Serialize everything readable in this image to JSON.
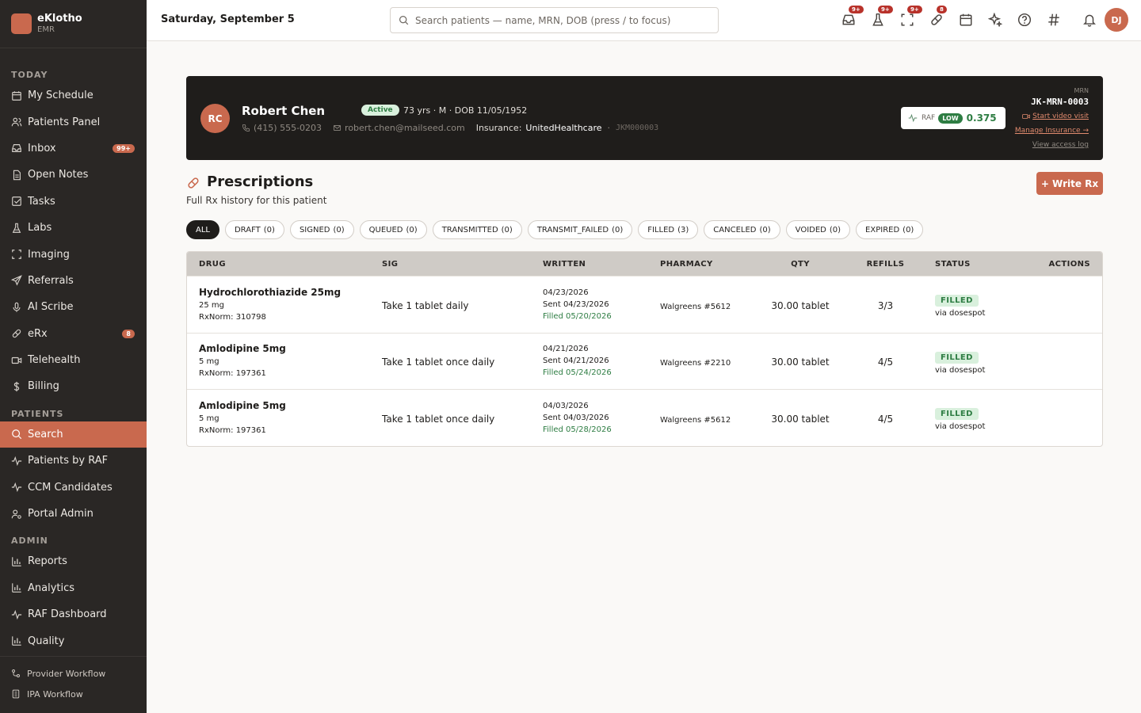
{
  "app": {
    "name": "eKlotho",
    "sub": "EMR"
  },
  "sidebar": {
    "sections": [
      {
        "title": "TODAY",
        "items": [
          {
            "label": "My Schedule",
            "icon": "calendar-icon"
          },
          {
            "label": "Patients Panel",
            "icon": "users-icon"
          },
          {
            "label": "Inbox",
            "icon": "inbox-icon",
            "badge": "99+"
          },
          {
            "label": "Open Notes",
            "icon": "note-icon"
          },
          {
            "label": "Tasks",
            "icon": "check-square-icon"
          },
          {
            "label": "Labs",
            "icon": "flask-icon"
          },
          {
            "label": "Imaging",
            "icon": "scan-icon"
          },
          {
            "label": "Referrals",
            "icon": "send-icon"
          },
          {
            "label": "AI Scribe",
            "icon": "mic-icon"
          },
          {
            "label": "eRx",
            "icon": "pill-icon",
            "badge": "8"
          },
          {
            "label": "Telehealth",
            "icon": "video-icon"
          },
          {
            "label": "Billing",
            "icon": "dollar-icon"
          }
        ]
      },
      {
        "title": "PATIENTS",
        "items": [
          {
            "label": "Search",
            "icon": "search-icon",
            "active": true
          },
          {
            "label": "Patients by RAF",
            "icon": "activity-icon"
          },
          {
            "label": "CCM Candidates",
            "icon": "activity-icon"
          },
          {
            "label": "Portal Admin",
            "icon": "user-cog-icon"
          }
        ]
      },
      {
        "title": "ADMIN",
        "items": [
          {
            "label": "Reports",
            "icon": "bar-chart-icon"
          },
          {
            "label": "Analytics",
            "icon": "bar-chart-icon"
          },
          {
            "label": "RAF Dashboard",
            "icon": "activity-icon"
          },
          {
            "label": "Quality",
            "icon": "bar-chart-icon"
          }
        ]
      }
    ],
    "footer": [
      {
        "label": "Provider Workflow",
        "icon": "workflow-icon"
      },
      {
        "label": "IPA Workflow",
        "icon": "building-icon"
      }
    ]
  },
  "topbar": {
    "date": "Saturday, September 5",
    "search_placeholder": "Search patients — name, MRN, DOB (press / to focus)",
    "icons": [
      {
        "name": "inbox-icon",
        "badge": "9+"
      },
      {
        "name": "flask-icon",
        "badge": "9+"
      },
      {
        "name": "scan-icon",
        "badge": "9+"
      },
      {
        "name": "pill-icon",
        "badge": "8"
      },
      {
        "name": "calendar-icon",
        "badge": ""
      },
      {
        "name": "sparkles-icon",
        "badge": ""
      },
      {
        "name": "help-icon",
        "badge": ""
      },
      {
        "name": "hash-icon",
        "badge": ""
      },
      {
        "name": "bell-icon",
        "badge": ""
      }
    ],
    "user_initials": "DJ"
  },
  "patient": {
    "initials": "RC",
    "name": "Robert Chen",
    "status": "Active",
    "demographics": "73 yrs · M · DOB 11/05/1952",
    "phone": "(415) 555-0203",
    "email": "robert.chen@mailseed.com",
    "insurance_label": "Insurance:",
    "insurance": "UnitedHealthcare",
    "dot": "·",
    "member_id": "JKM000003",
    "raf_label": "RAF",
    "raf_level": "LOW",
    "raf_score": "0.375",
    "mrn_label": "MRN",
    "mrn": "JK-MRN-0003",
    "start_video": "Start video visit",
    "manage_insurance": "Manage Insurance →",
    "view_access_log": "View access log"
  },
  "prescriptions": {
    "title": "Prescriptions",
    "subtitle": "Full Rx history for this patient",
    "write_button": "+ Write Rx",
    "filters": [
      {
        "label": "ALL",
        "count": "",
        "active": true
      },
      {
        "label": "DRAFT",
        "count": "(0)"
      },
      {
        "label": "SIGNED",
        "count": "(0)"
      },
      {
        "label": "QUEUED",
        "count": "(0)"
      },
      {
        "label": "TRANSMITTED",
        "count": "(0)"
      },
      {
        "label": "TRANSMIT_FAILED",
        "count": "(0)"
      },
      {
        "label": "FILLED",
        "count": "(3)"
      },
      {
        "label": "CANCELED",
        "count": "(0)"
      },
      {
        "label": "VOIDED",
        "count": "(0)"
      },
      {
        "label": "EXPIRED",
        "count": "(0)"
      }
    ],
    "columns": {
      "drug": "DRUG",
      "sig": "SIG",
      "written": "WRITTEN",
      "pharmacy": "PHARMACY",
      "qty": "QTY",
      "refills": "REFILLS",
      "status": "STATUS",
      "actions": "ACTIONS"
    },
    "rows": [
      {
        "drug": "Hydrochlorothiazide 25mg",
        "strength": "25 mg",
        "rxnorm": "RxNorm: 310798",
        "sig": "Take 1 tablet daily",
        "written": "04/23/2026",
        "sent": "Sent 04/23/2026",
        "filled": "Filled 05/20/2026",
        "pharmacy": "Walgreens #5612",
        "qty": "30.00 tablet",
        "refills": "3/3",
        "status": "FILLED",
        "via": "via dosespot"
      },
      {
        "drug": "Amlodipine 5mg",
        "strength": "5 mg",
        "rxnorm": "RxNorm: 197361",
        "sig": "Take 1 tablet once daily",
        "written": "04/21/2026",
        "sent": "Sent 04/21/2026",
        "filled": "Filled 05/24/2026",
        "pharmacy": "Walgreens #2210",
        "qty": "30.00 tablet",
        "refills": "4/5",
        "status": "FILLED",
        "via": "via dosespot"
      },
      {
        "drug": "Amlodipine 5mg",
        "strength": "5 mg",
        "rxnorm": "RxNorm: 197361",
        "sig": "Take 1 tablet once daily",
        "written": "04/03/2026",
        "sent": "Sent 04/03/2026",
        "filled": "Filled 05/28/2026",
        "pharmacy": "Walgreens #5612",
        "qty": "30.00 tablet",
        "refills": "4/5",
        "status": "FILLED",
        "via": "via dosespot"
      }
    ]
  },
  "colors": {
    "accent": "#c9694e",
    "sidebar": "#2a2725",
    "success": "#2e7d43",
    "badge_red": "#b8322a"
  }
}
